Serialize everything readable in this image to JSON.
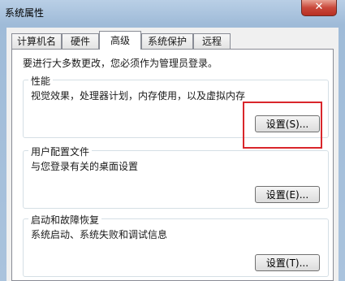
{
  "window": {
    "title": "系统属性",
    "close_glyph": "✕"
  },
  "tabs": [
    {
      "label": "计算机名"
    },
    {
      "label": "硬件"
    },
    {
      "label": "高级",
      "active": true
    },
    {
      "label": "系统保护"
    },
    {
      "label": "远程"
    }
  ],
  "notice": "要进行大多数更改，您必须作为管理员登录。",
  "performance": {
    "title": "性能",
    "description": "视觉效果，处理器计划，内存使用，以及虚拟内存",
    "button": "设置(S)..."
  },
  "user_profiles": {
    "title": "用户配置文件",
    "description": "与您登录有关的桌面设置",
    "button": "设置(E)..."
  },
  "startup_recovery": {
    "title": "启动和故障恢复",
    "description": "系统启动、系统失败和调试信息",
    "button": "设置(T)..."
  },
  "colors": {
    "highlight": "#d9262b"
  }
}
